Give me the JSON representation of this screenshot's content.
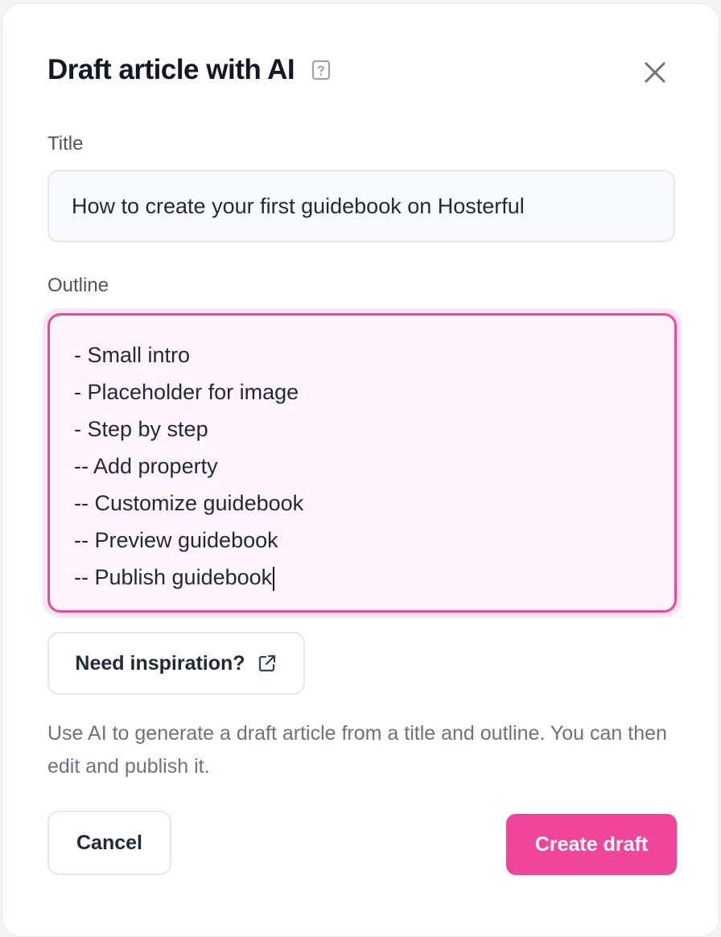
{
  "dialog": {
    "title": "Draft article with AI"
  },
  "fields": {
    "title_label": "Title",
    "title_value": "How to create your first guidebook on Hosterful",
    "outline_label": "Outline",
    "outline_lines": [
      "- Small intro",
      "- Placeholder for image",
      "- Step by step",
      "-- Add property",
      "-- Customize guidebook",
      "-- Preview guidebook",
      "-- Publish guidebook"
    ]
  },
  "inspiration": {
    "label": "Need inspiration?"
  },
  "helper_text": "Use AI to generate a draft article from a title and outline. You can then edit and publish it.",
  "actions": {
    "cancel_label": "Cancel",
    "create_label": "Create draft"
  },
  "icons": {
    "help": "help-icon",
    "close": "close-icon",
    "external_link": "external-link-icon"
  },
  "colors": {
    "accent": "#ec4899",
    "primary_button": "#f0459a",
    "outline_bg": "#fff4fa"
  }
}
